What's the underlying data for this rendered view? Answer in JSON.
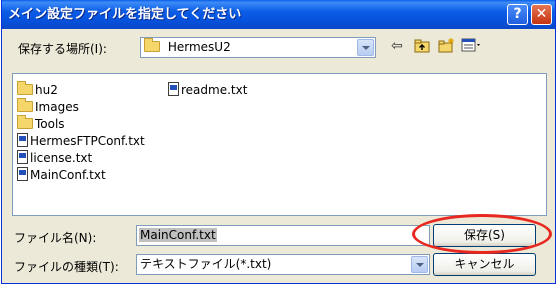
{
  "dialog": {
    "title": "メイン設定ファイルを指定してください",
    "help_symbol": "?",
    "close_symbol": "✕"
  },
  "location": {
    "label": "保存する場所(I):",
    "value": "HermesU2"
  },
  "toolbar": {
    "back_icon": "back-arrow-icon",
    "up_icon": "up-folder-icon",
    "new_folder_icon": "new-folder-icon",
    "view_icon": "view-menu-icon"
  },
  "files": {
    "items": [
      {
        "type": "folder",
        "name": "hu2"
      },
      {
        "type": "folder",
        "name": "Images"
      },
      {
        "type": "folder",
        "name": "Tools"
      },
      {
        "type": "file",
        "name": "HermesFTPConf.txt"
      },
      {
        "type": "file",
        "name": "license.txt"
      },
      {
        "type": "file",
        "name": "MainConf.txt"
      },
      {
        "type": "file",
        "name": "readme.txt"
      }
    ]
  },
  "filename": {
    "label": "ファイル名(N):",
    "value": "MainConf.txt"
  },
  "filetype": {
    "label": "ファイルの種類(T):",
    "value": "テキストファイル(*.txt)"
  },
  "buttons": {
    "save": "保存(S)",
    "cancel": "キャンセル"
  },
  "colors": {
    "title_bar": "#0a5fe8",
    "dialog_bg": "#ece9d8",
    "highlight_ring": "#e8281f"
  }
}
